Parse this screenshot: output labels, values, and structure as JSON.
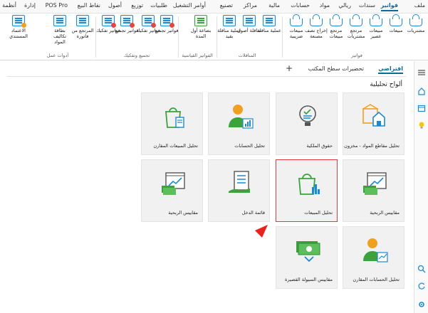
{
  "ribbon_tabs": [
    "ملف",
    "فواتير",
    "سندات",
    "ريالي",
    "مواد",
    "حسابات",
    "مالية",
    "مراكز",
    "تصنيع",
    "أوامر التشغيل",
    "طلبيات",
    "توزيع",
    "أصول",
    "نقاط البيع",
    "POS Pro",
    "إدارة",
    "أنظمة"
  ],
  "ribbon": {
    "invoices": {
      "purchases": "مشتريات",
      "sales": "مبيعات",
      "sales_returns": "مبيعات عصير",
      "purchases_returns": "مرتجع مشتريات",
      "sales_returns2": "مرتجع مبيعات",
      "out_issue": "إخراج نصف مصنعة",
      "sales_tax": "مبيعات ضريبية",
      "group_label": "فواتير"
    },
    "transfers": {
      "transfer": "عملية مناقلة",
      "asset_transfer": "مناقلة أصول",
      "cash_transfer": "عملية مناقلة بقيد",
      "group_label": "المناقلات"
    },
    "standard_invoices": {
      "first_period": "بضاعة أول المدة",
      "group_label": "الفواتير القياسية"
    },
    "group_ops": {
      "invoices_merge": "فواتير تجميع",
      "invoices_split": "فواتير تفكيك",
      "invoices_merge2": "فواتير تجميع",
      "invoices_split2": "فواتير تفكيك",
      "group_label": "تجميع وتفكيك"
    },
    "tools": {
      "returned_invoice": "المرتجع من فاتورة",
      "cost_card": "بطاقة تكاليف المواد",
      "approval": "الاعتماد المستندي",
      "group_label": "أدوات عمل"
    }
  },
  "page_tabs": {
    "default": "افتراضي",
    "desktop_sections": "تحضيرات سطح المكتب",
    "add": "+"
  },
  "section_title": "ألواح تحليلية",
  "tiles": [
    {
      "caption": "تحليل مقاطع المواد - مخزون",
      "icon": "inventory-analysis-icon"
    },
    {
      "caption": "حقوق الملكية",
      "icon": "equity-icon"
    },
    {
      "caption": "تحليل الحسابات",
      "icon": "accounts-analysis-icon"
    },
    {
      "caption": "تحليل المبيعات المقارن",
      "icon": "comparative-sales-icon"
    },
    {
      "caption": "مقاييس الربحية",
      "icon": "profitability-icon"
    },
    {
      "caption": "تحليل المبيعات",
      "icon": "sales-analysis-icon"
    },
    {
      "caption": "قائمة الدخل",
      "icon": "income-statement-icon"
    },
    {
      "caption": "مقاييس الربحية",
      "icon": "profitability-icon"
    },
    {
      "caption": "تحليل الحسابات المقارن",
      "icon": "comparative-accounts-icon"
    },
    {
      "caption": "مقاييس السيولة القصيرة",
      "icon": "short-liquidity-icon"
    }
  ],
  "colors": {
    "accent": "#0a6a9c",
    "icon_blue": "#1c8ad3",
    "icon_green": "#3ca33c",
    "selection_red": "#e23b3b",
    "arrow_red": "#e8221c"
  }
}
